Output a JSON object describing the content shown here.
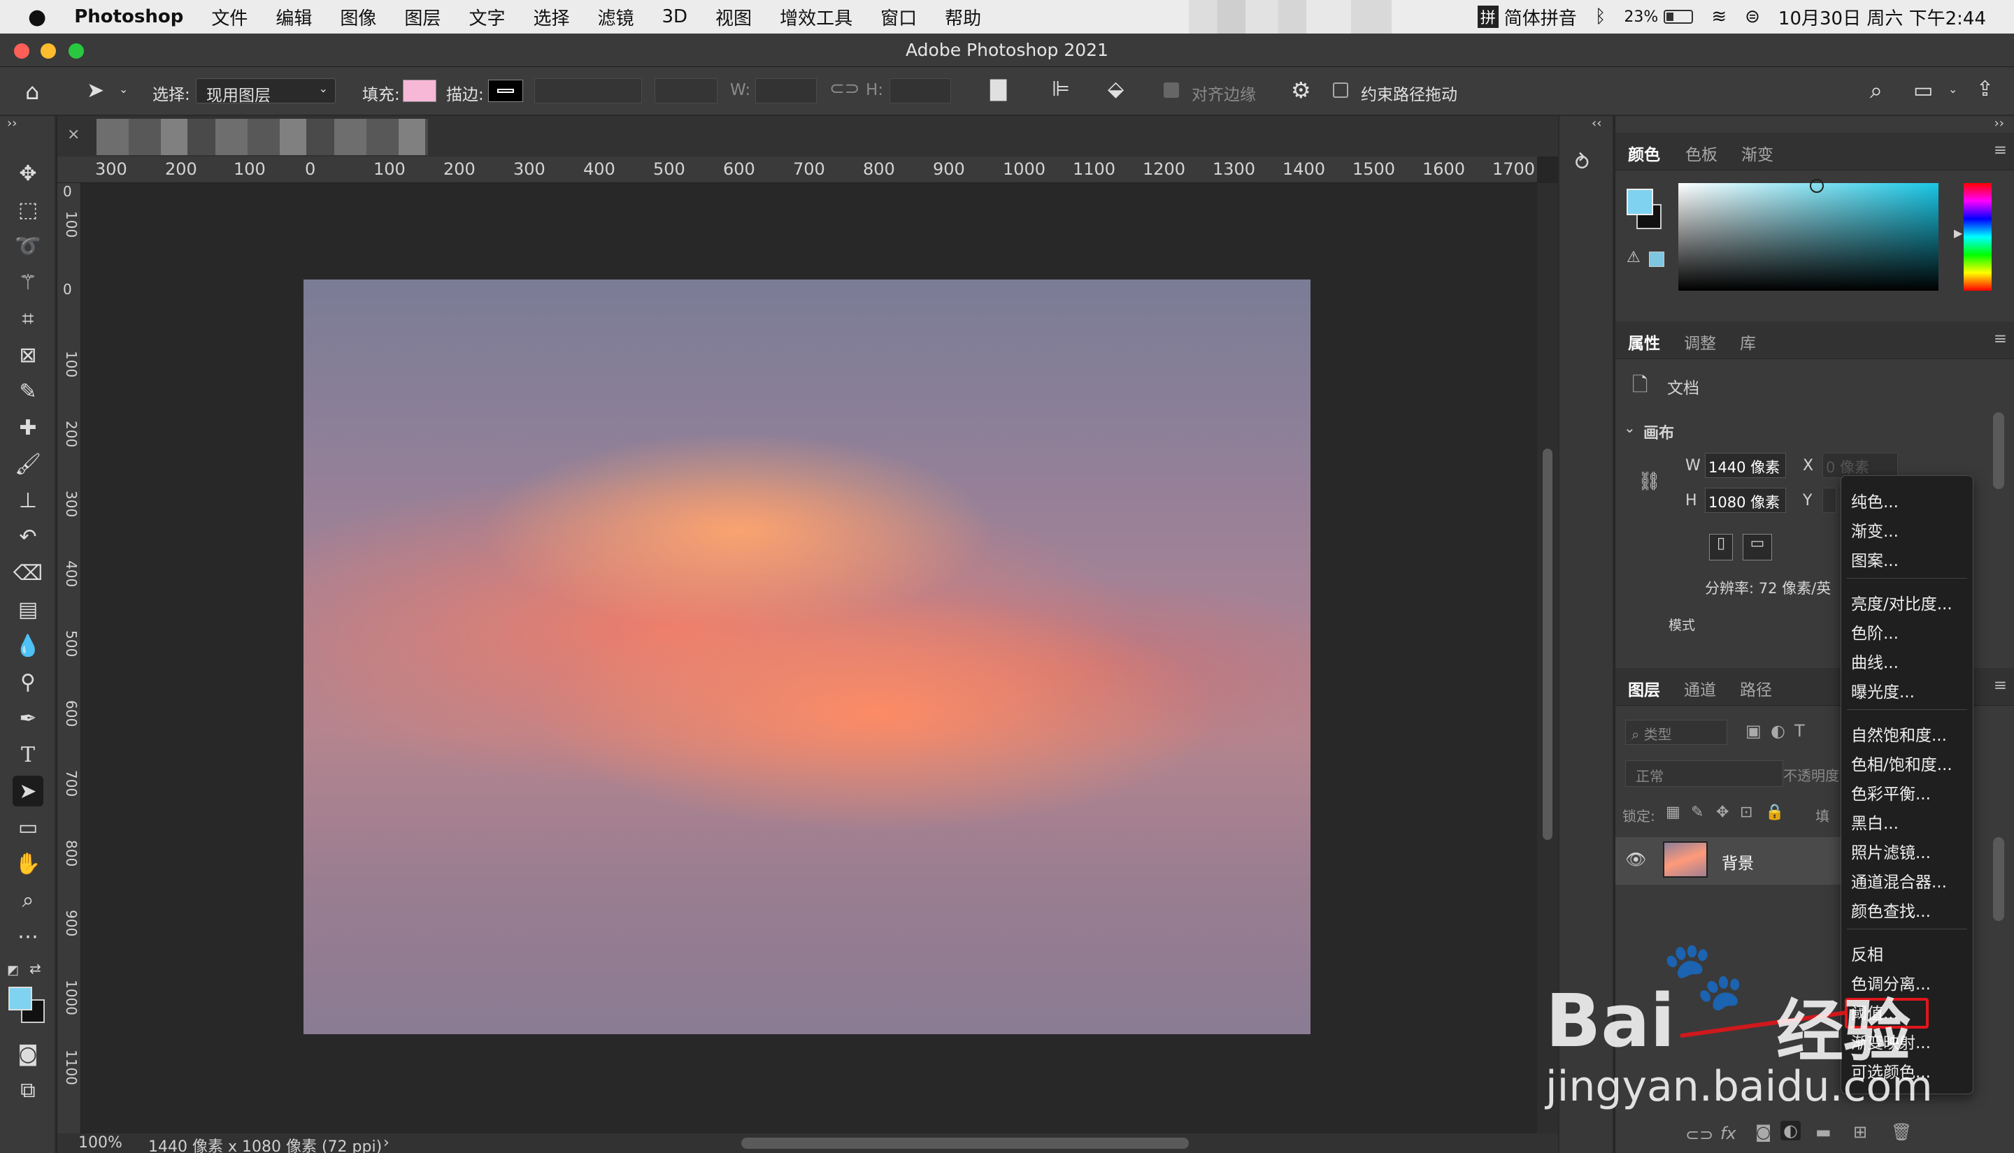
{
  "menubar": {
    "apple": "",
    "app": "Photoshop",
    "items": [
      "文件",
      "编辑",
      "图像",
      "图层",
      "文字",
      "选择",
      "滤镜",
      "3D",
      "视图",
      "增效工具",
      "窗口",
      "帮助"
    ],
    "input_method": "简体拼音",
    "battery": "23%",
    "datetime": "10月30日 周六 下午2:44"
  },
  "window": {
    "title": "Adobe Photoshop 2021"
  },
  "options": {
    "select_label": "选择:",
    "select_value": "现用图层",
    "fill_label": "填充:",
    "stroke_label": "描边:",
    "w_label": "W:",
    "h_label": "H:",
    "align_edges": "对齐边缘",
    "constrain_path": "约束路径拖动",
    "fill_color": "#f7b7d6"
  },
  "ruler_h": [
    "300",
    "200",
    "100",
    "0",
    "100",
    "200",
    "300",
    "400",
    "500",
    "600",
    "700",
    "800",
    "900",
    "1000",
    "1100",
    "1200",
    "1300",
    "1400",
    "1500",
    "1600",
    "1700"
  ],
  "ruler_v": [
    "0",
    "100",
    "0",
    "100",
    "200",
    "300",
    "400",
    "500",
    "600",
    "700",
    "800",
    "900",
    "1000",
    "1100"
  ],
  "status": {
    "zoom": "100%",
    "info": "1440 像素 x 1080 像素 (72 ppi)",
    "arrow": "›"
  },
  "color_panel": {
    "tabs": [
      "颜色",
      "色板",
      "渐变"
    ],
    "fg": "#7fd3f0",
    "bg": "#111111"
  },
  "properties": {
    "tabs": [
      "属性",
      "调整",
      "库"
    ],
    "doc_label": "文档",
    "canvas_label": "画布",
    "w_label": "W",
    "w_value": "1440 像素",
    "h_label": "H",
    "h_value": "1080 像素",
    "x_label": "X",
    "x_placeholder": "0 像素",
    "y_label": "Y",
    "resolution": "分辨率: 72 像素/英",
    "mode": "模式"
  },
  "layers": {
    "tabs": [
      "图层",
      "通道",
      "路径"
    ],
    "filter": "类型",
    "blend": "正常",
    "opacity": "不透明度",
    "lock_label": "锁定:",
    "fill_label": "填",
    "layer_name": "背景"
  },
  "context_menu": {
    "group1": [
      "纯色...",
      "渐变...",
      "图案..."
    ],
    "group2": [
      "亮度/对比度...",
      "色阶...",
      "曲线...",
      "曝光度..."
    ],
    "group3": [
      "自然饱和度...",
      "色相/饱和度...",
      "色彩平衡...",
      "黑白...",
      "照片滤镜...",
      "通道混合器...",
      "颜色查找..."
    ],
    "group4": [
      "反相",
      "色调分离...",
      "阈值...",
      "渐变映射...",
      "可选颜色..."
    ]
  },
  "watermark": {
    "brand_left": "Bai",
    "brand_right": "经验",
    "url": "jingyan.baidu.com"
  }
}
